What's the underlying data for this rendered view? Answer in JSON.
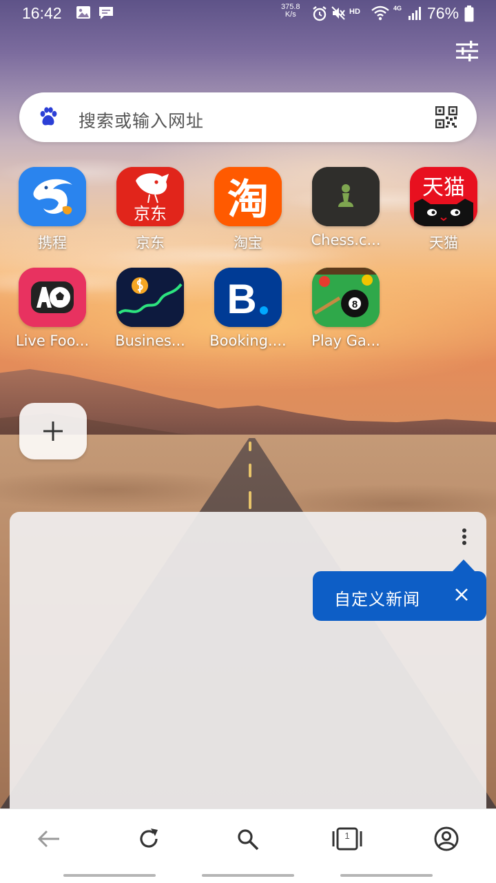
{
  "status_bar": {
    "time": "16:42",
    "network_speed_value": "375.8",
    "network_speed_unit": "K/s",
    "hd_label": "HD",
    "network_type": "4G",
    "battery_percent": "76%"
  },
  "search": {
    "placeholder": "搜索或输入网址"
  },
  "shortcuts": [
    {
      "label": "携程"
    },
    {
      "label": "京东"
    },
    {
      "label": "淘宝"
    },
    {
      "label": "Chess.c..."
    },
    {
      "label": "天猫"
    },
    {
      "label": "Live Foo..."
    },
    {
      "label": "Busines..."
    },
    {
      "label": "Booking...."
    },
    {
      "label": "Play Ga..."
    }
  ],
  "app_icon_text": {
    "jd": "京东",
    "taobao": "淘",
    "tmall": "天猫",
    "booking": "B",
    "ball": "8"
  },
  "news": {
    "tooltip_text": "自定义新闻"
  },
  "bottom_nav": {
    "tab_count": "1"
  },
  "colors": {
    "accent": "#0d5ec6",
    "paw": "#2b3fd6"
  }
}
